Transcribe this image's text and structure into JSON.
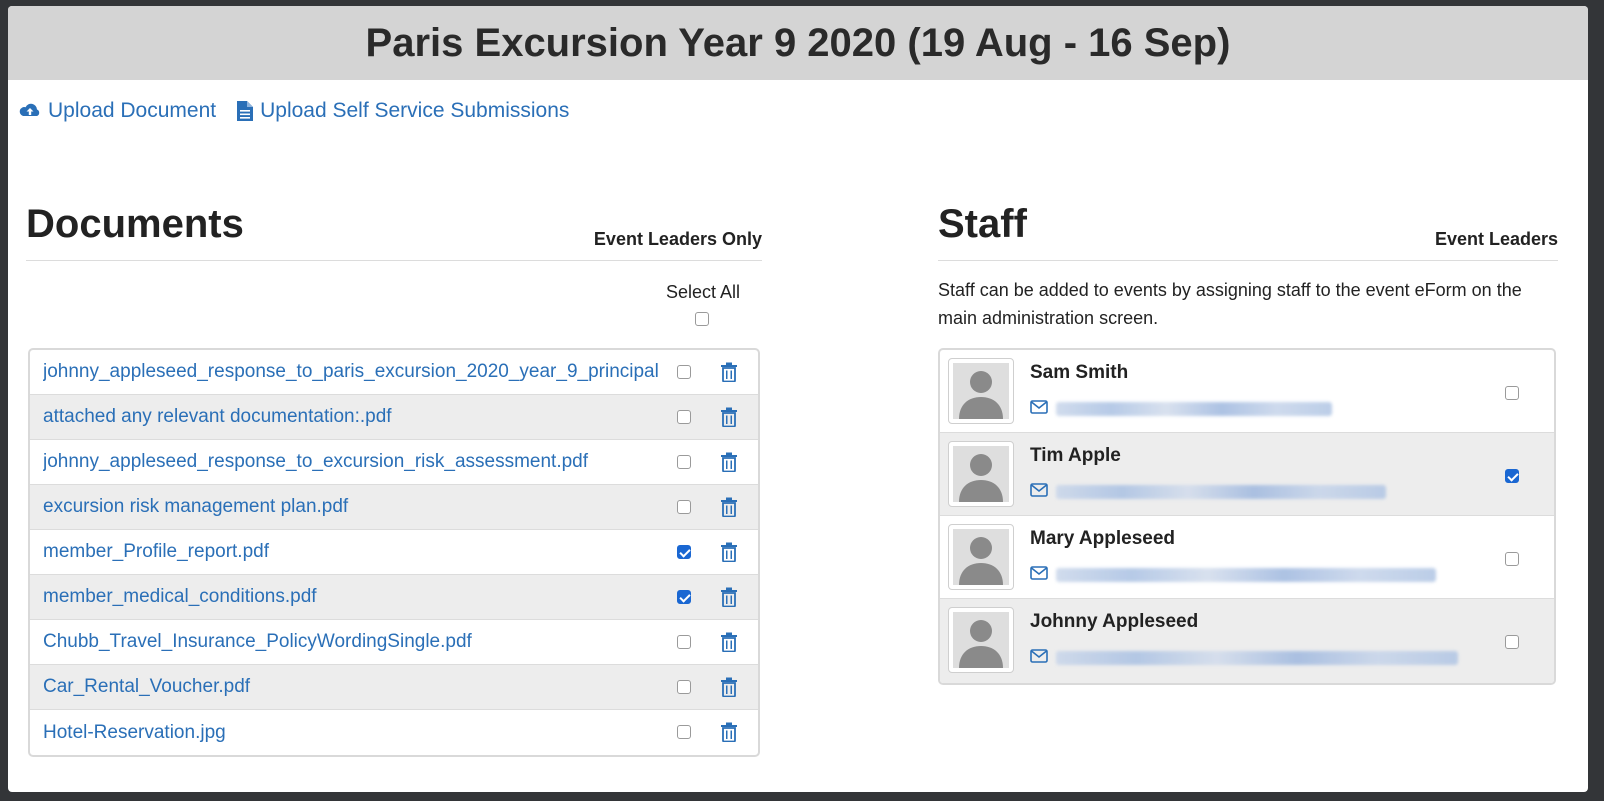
{
  "page_title": "Paris Excursion Year 9 2020 (19 Aug - 16 Sep)",
  "actions": {
    "upload_document": "Upload Document",
    "upload_self_service": "Upload Self Service Submissions"
  },
  "documents": {
    "title": "Documents",
    "header_right": "Event Leaders Only",
    "select_all_label": "Select All",
    "select_all_checked": false,
    "items": [
      {
        "name": "johnny_appleseed_response_to_paris_excursion_2020_year_9_principal",
        "checked": false
      },
      {
        "name": "attached any relevant documentation:.pdf",
        "checked": false
      },
      {
        "name": "johnny_appleseed_response_to_excursion_risk_assessment.pdf",
        "checked": false
      },
      {
        "name": "excursion risk management plan.pdf",
        "checked": false
      },
      {
        "name": "member_Profile_report.pdf",
        "checked": true
      },
      {
        "name": "member_medical_conditions.pdf",
        "checked": true
      },
      {
        "name": "Chubb_Travel_Insurance_PolicyWordingSingle.pdf",
        "checked": false
      },
      {
        "name": "Car_Rental_Voucher.pdf",
        "checked": false
      },
      {
        "name": "Hotel-Reservation.jpg",
        "checked": false
      }
    ]
  },
  "staff": {
    "title": "Staff",
    "header_right": "Event Leaders",
    "description": "Staff can be added to events by assigning staff to the event eForm on the main administration screen.",
    "members": [
      {
        "name": "Sam Smith",
        "is_leader": false
      },
      {
        "name": "Tim Apple",
        "is_leader": true
      },
      {
        "name": "Mary Appleseed",
        "is_leader": false
      },
      {
        "name": "Johnny Appleseed",
        "is_leader": false
      }
    ]
  },
  "colors": {
    "link": "#2a6fb7",
    "title_bar": "#d4d4d4",
    "checkbox_checked": "#1a67d2",
    "row_alt": "#ededed"
  }
}
